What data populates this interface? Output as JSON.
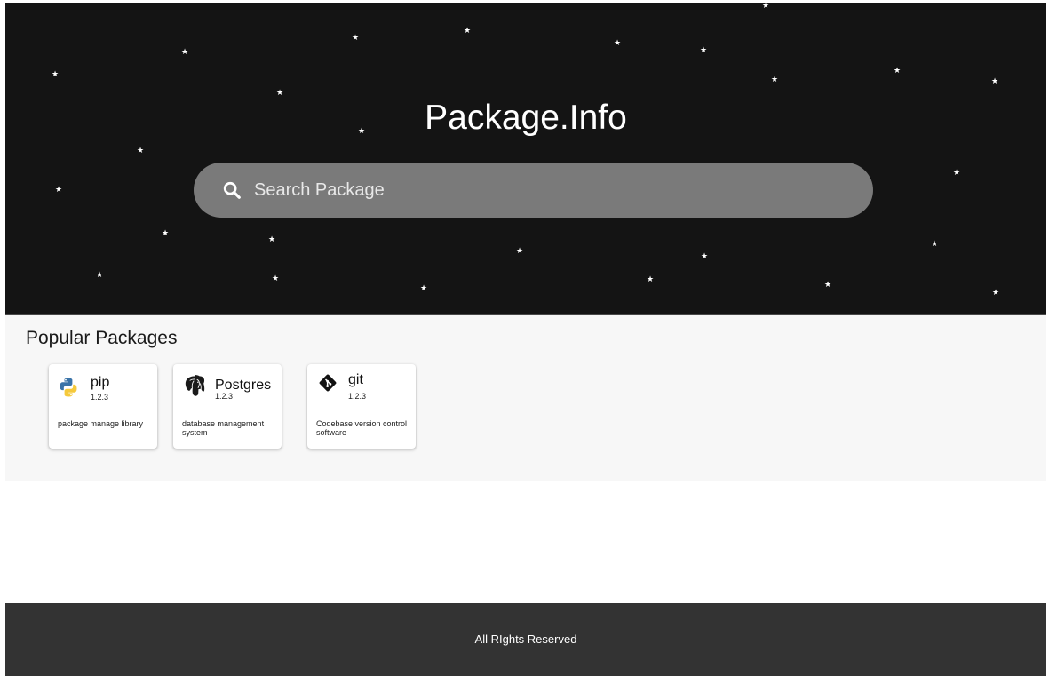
{
  "header": {
    "title": "Package.Info"
  },
  "search": {
    "placeholder": "Search Package",
    "value": "",
    "icon": "search-icon"
  },
  "popular": {
    "title": "Popular Packages",
    "packages": [
      {
        "name": "pip",
        "version": "1.2.3",
        "description": "package manage library",
        "icon": "python-icon"
      },
      {
        "name": "Postgres",
        "version": "1.2.3",
        "description": "database management system",
        "icon": "postgres-elephant-icon"
      },
      {
        "name": "git",
        "version": "1.2.3",
        "description": "Codebase version control software",
        "icon": "git-icon"
      }
    ]
  },
  "footer": {
    "text": "All RIghts Reserved"
  },
  "colors": {
    "hero_bg": "#141414",
    "search_bg": "#7a7a7a",
    "section_bg": "#f7f7f7",
    "footer_bg": "#333333"
  }
}
